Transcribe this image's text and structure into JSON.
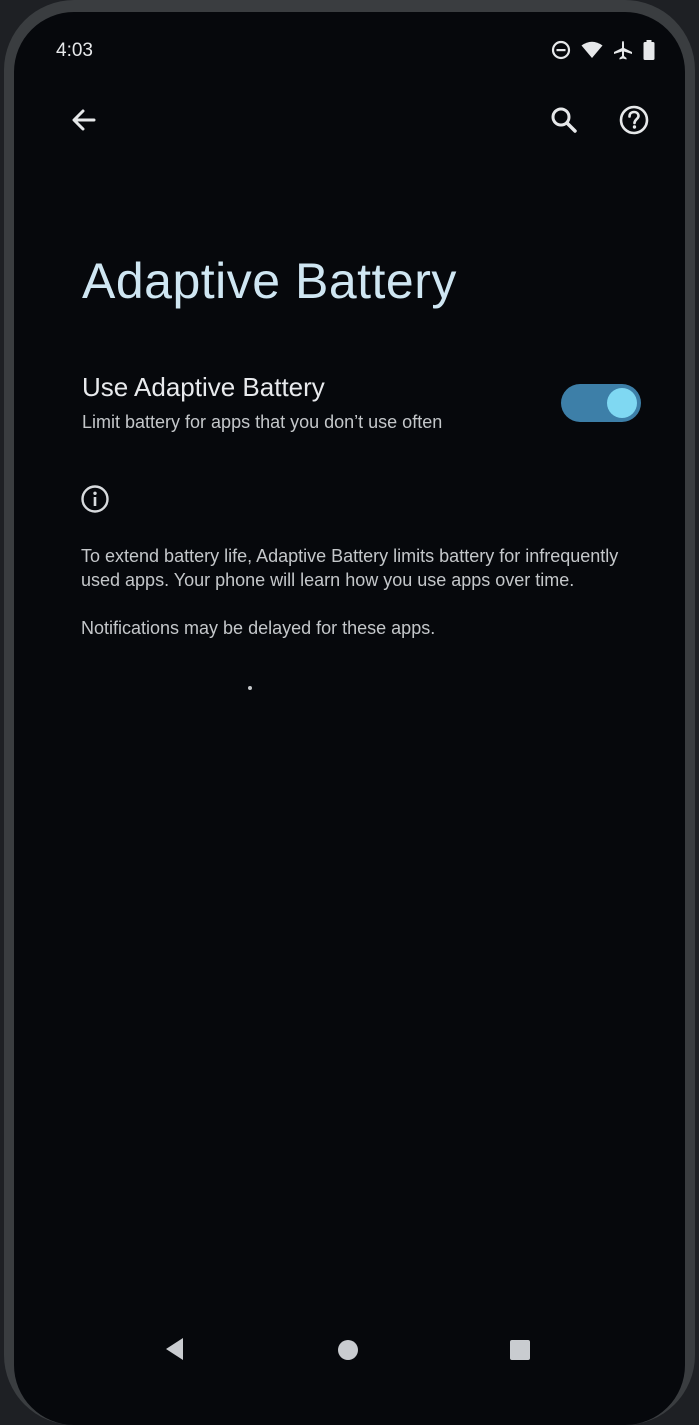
{
  "status_bar": {
    "time": "4:03",
    "icons": [
      "dnd-icon",
      "wifi-icon",
      "airplane-icon",
      "battery-icon"
    ]
  },
  "app_bar": {
    "back_icon": "arrow-back-icon",
    "search_icon": "search-icon",
    "help_icon": "help-icon"
  },
  "page": {
    "title": "Adaptive Battery"
  },
  "adaptive_battery_toggle": {
    "title": "Use Adaptive Battery",
    "summary": "Limit battery for apps that you don’t use often",
    "checked": true
  },
  "footer": {
    "info_icon": "info-icon",
    "paragraphs": [
      "To extend battery life, Adaptive Battery limits battery for infrequently used apps. Your phone will learn how you use apps over time.",
      "Notifications may be delayed for these apps."
    ]
  },
  "nav_bar": {
    "back": "nav-back-icon",
    "home": "nav-home-icon",
    "recents": "nav-recents-icon"
  },
  "colors": {
    "background": "#06080c",
    "title": "#cfe6f2",
    "switch_track": "#3d7fa8",
    "switch_thumb": "#7fd8f2",
    "text_primary": "#e8eaed",
    "text_secondary": "#c4c7ca"
  }
}
